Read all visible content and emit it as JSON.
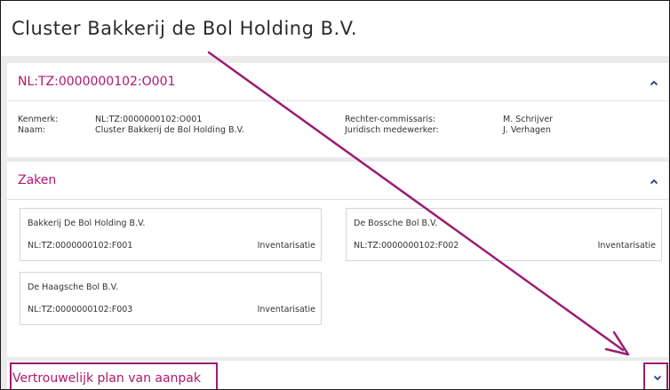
{
  "page_title": "Cluster Bakkerij de Bol Holding B.V.",
  "cluster_panel": {
    "heading": "NL:TZ:0000000102:O001",
    "kenmerk_label": "Kenmerk:",
    "kenmerk_value": "NL:TZ:0000000102:O001",
    "naam_label": "Naam:",
    "naam_value": "Cluster Bakkerij de Bol Holding B.V.",
    "rechter_label": "Rechter-commissaris:",
    "rechter_value": "M. Schrijver",
    "juridisch_label": "Juridisch medewerker:",
    "juridisch_value": "J. Verhagen"
  },
  "zaken_panel": {
    "heading": "Zaken",
    "cards": [
      {
        "name": "Bakkerij De Bol Holding B.V.",
        "number": "NL:TZ:0000000102:F001",
        "status": "Inventarisatie"
      },
      {
        "name": "De Bossche Bol B.V.",
        "number": "NL:TZ:0000000102:F002",
        "status": "Inventarisatie"
      },
      {
        "name": "De Haagsche Bol B.V.",
        "number": "NL:TZ:0000000102:F003",
        "status": "Inventarisatie"
      }
    ]
  },
  "plan_panel": {
    "heading": "Vertrouwelijk plan van aanpak"
  },
  "icons": {
    "collapse": "chevron-up-icon",
    "expand": "chevron-down-icon"
  },
  "colors": {
    "heading_magenta": "#b0176e",
    "annotation_purple": "#9b1d73",
    "chevron": "#2d3a8c"
  }
}
